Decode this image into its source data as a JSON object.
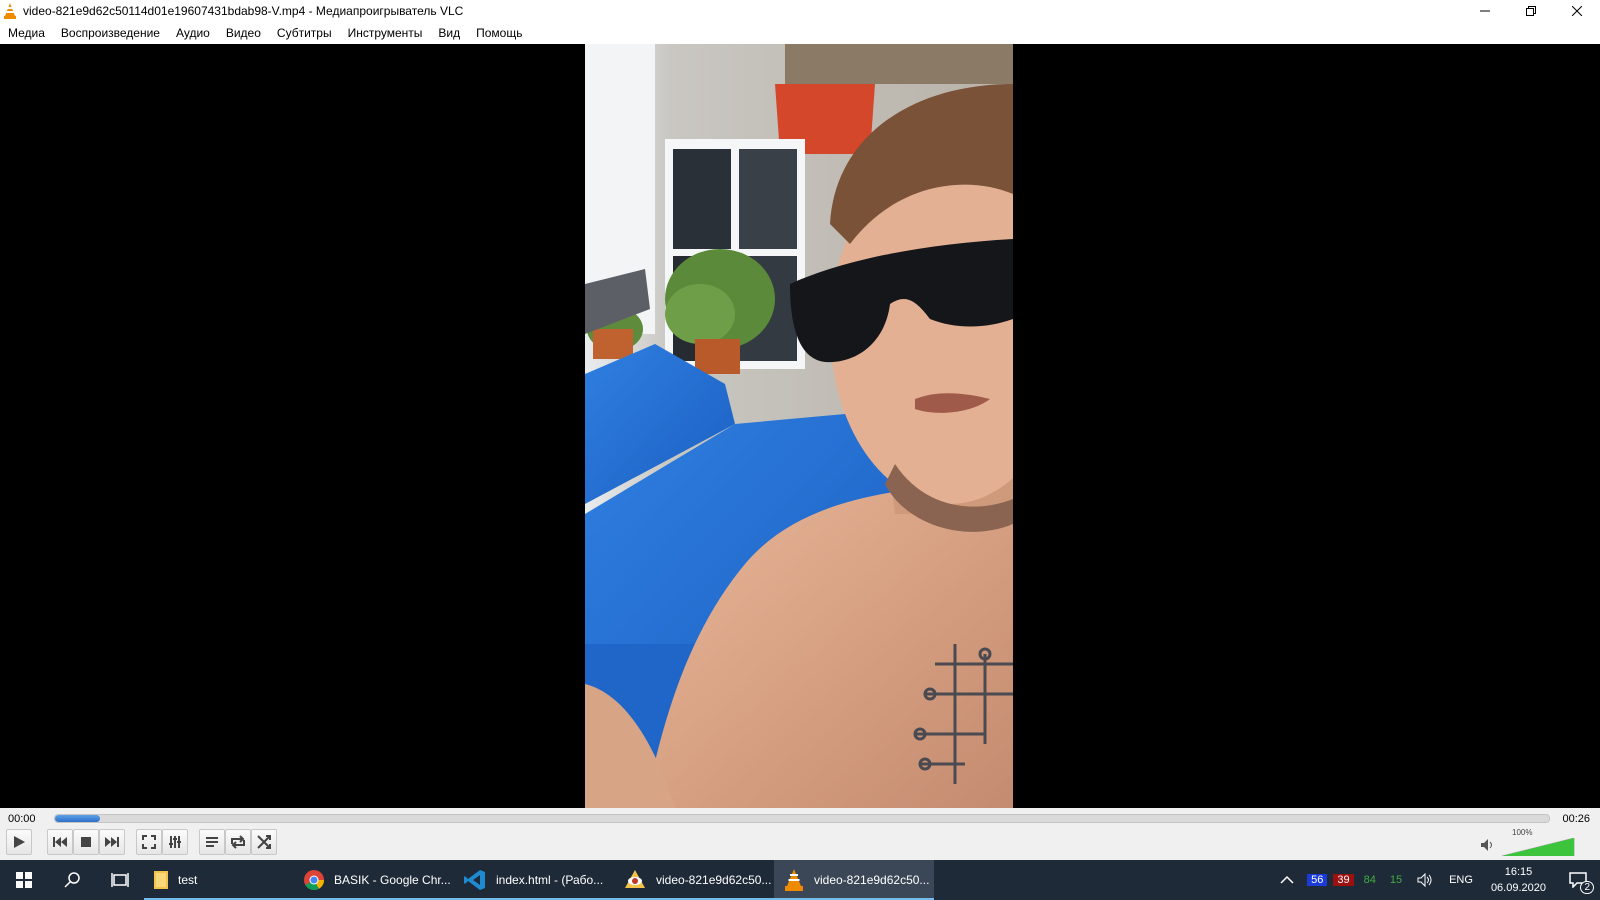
{
  "window": {
    "title": "video-821e9d62c50114d01e19607431bdab98-V.mp4 - Медиапроигрыватель VLC"
  },
  "menu": {
    "items": [
      "Медиа",
      "Воспроизведение",
      "Аудио",
      "Видео",
      "Субтитры",
      "Инструменты",
      "Вид",
      "Помощь"
    ]
  },
  "player": {
    "current_time": "00:00",
    "duration": "00:26",
    "progress_fraction": 0.03,
    "volume_label": "100%",
    "volume_fraction": 1.0
  },
  "taskbar": {
    "apps": [
      {
        "label": "test",
        "icon": "folder-icon"
      },
      {
        "label": "BASIK - Google Chr...",
        "icon": "chrome-icon"
      },
      {
        "label": "index.html - (Рабо...",
        "icon": "vscode-icon"
      },
      {
        "label": "video-821e9d62c50...",
        "icon": "viewer-icon"
      },
      {
        "label": "video-821e9d62c50...",
        "icon": "vlc-icon"
      }
    ],
    "tray": {
      "counters": [
        "56",
        "39",
        "84",
        "15"
      ],
      "counter_colors": [
        "#1a3bd6",
        "#9c1010",
        "#3fae3f",
        "#3fae3f"
      ],
      "language": "ENG",
      "time": "16:15",
      "date": "06.09.2020",
      "notifications": "2"
    }
  },
  "colors": {
    "accent": "#2c6fc9",
    "taskbar": "#1f2a38"
  }
}
